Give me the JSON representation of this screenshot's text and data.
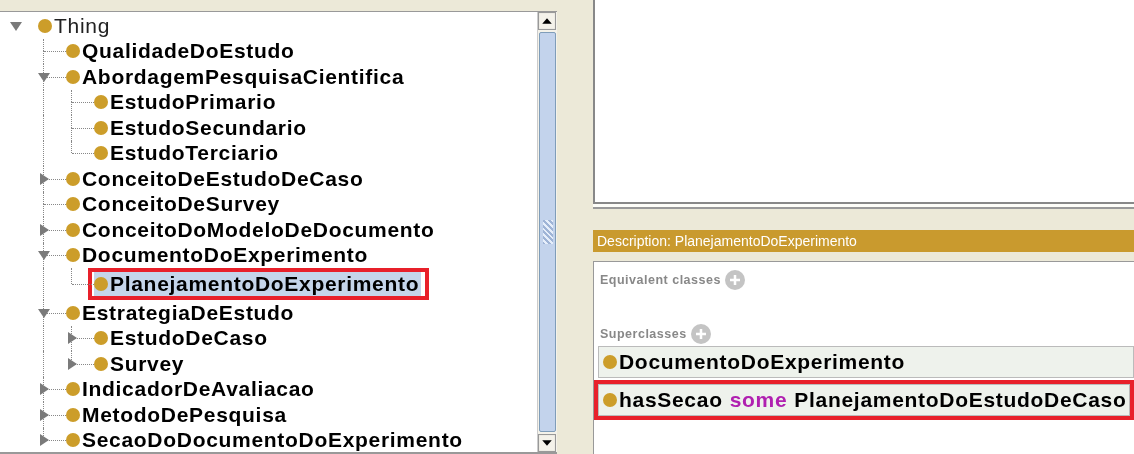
{
  "tree": [
    {
      "label": "Thing",
      "kind": "branch",
      "expanded": true,
      "selected": false,
      "highlighted": false,
      "children": [
        {
          "label": "QualidadeDoEstudo",
          "kind": "leaf",
          "selected": false,
          "highlighted": false
        },
        {
          "label": "AbordagemPesquisaCientifica",
          "kind": "branch",
          "expanded": true,
          "selected": false,
          "highlighted": false,
          "children": [
            {
              "label": "EstudoPrimario",
              "kind": "leaf",
              "selected": false,
              "highlighted": false
            },
            {
              "label": "EstudoSecundario",
              "kind": "leaf",
              "selected": false,
              "highlighted": false
            },
            {
              "label": "EstudoTerciario",
              "kind": "leaf",
              "selected": false,
              "highlighted": false
            }
          ]
        },
        {
          "label": "ConceitoDeEstudoDeCaso",
          "kind": "branch",
          "expanded": false,
          "selected": false,
          "highlighted": false
        },
        {
          "label": "ConceitoDeSurvey",
          "kind": "leaf",
          "selected": false,
          "highlighted": false
        },
        {
          "label": "ConceitoDoModeloDeDocumento",
          "kind": "branch",
          "expanded": false,
          "selected": false,
          "highlighted": false
        },
        {
          "label": "DocumentoDoExperimento",
          "kind": "branch",
          "expanded": true,
          "selected": false,
          "highlighted": false,
          "children": [
            {
              "label": "PlanejamentoDoExperimento",
              "kind": "leaf",
              "selected": true,
              "highlighted": true
            }
          ]
        },
        {
          "label": "EstrategiaDeEstudo",
          "kind": "branch",
          "expanded": true,
          "selected": false,
          "highlighted": false,
          "children": [
            {
              "label": "EstudoDeCaso",
              "kind": "branch",
              "expanded": false,
              "selected": false,
              "highlighted": false
            },
            {
              "label": "Survey",
              "kind": "branch",
              "expanded": false,
              "selected": false,
              "highlighted": false
            }
          ]
        },
        {
          "label": "IndicadorDeAvaliacao",
          "kind": "branch",
          "expanded": false,
          "selected": false,
          "highlighted": false
        },
        {
          "label": "MetodoDePesquisa",
          "kind": "branch",
          "expanded": false,
          "selected": false,
          "highlighted": false
        },
        {
          "label": "SecaoDoDocumentoDoExperimento",
          "kind": "branch",
          "expanded": false,
          "selected": false,
          "highlighted": false
        }
      ]
    }
  ],
  "description": {
    "title": "Description: PlanejamentoDoExperimento",
    "sections": [
      {
        "label": "Equivalent classes"
      },
      {
        "label": "Superclasses",
        "rows": [
          {
            "highlighted": false,
            "parts": [
              {
                "kind": "name",
                "text": "DocumentoDoExperimento"
              }
            ]
          },
          {
            "highlighted": true,
            "parts": [
              {
                "kind": "name",
                "text": "hasSecao"
              },
              {
                "kind": "keyword",
                "text": "some"
              },
              {
                "kind": "name",
                "text": "PlanejamentoDoEstudoDeCaso"
              }
            ]
          }
        ]
      }
    ]
  }
}
